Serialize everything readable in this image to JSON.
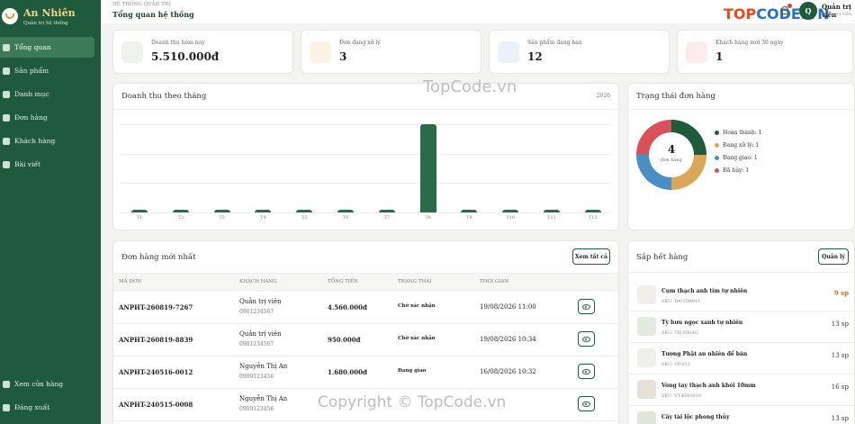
{
  "brand": {
    "name": "An Nhiên",
    "subtitle": "Quản trị hệ thống"
  },
  "nav": [
    {
      "label": "Tổng quan",
      "icon": "dashboard-icon",
      "active": true
    },
    {
      "label": "Sản phẩm",
      "icon": "tag-icon"
    },
    {
      "label": "Danh mục",
      "icon": "folder-icon"
    },
    {
      "label": "Đơn hàng",
      "icon": "receipt-icon"
    },
    {
      "label": "Khách hàng",
      "icon": "users-icon"
    },
    {
      "label": "Bài viết",
      "icon": "article-icon"
    }
  ],
  "nav_bottom": [
    {
      "label": "Xem cửa hàng",
      "icon": "store-icon"
    },
    {
      "label": "Đăng xuất",
      "icon": "logout-icon"
    }
  ],
  "topbar": {
    "small": "HỆ THỐNG QUẢN TRỊ",
    "title": "Tổng quan hệ thống",
    "avatar": "Q",
    "user": "Quản trị viên",
    "user_sub": "Quản trị viên"
  },
  "watermark_top": {
    "a": "TOP",
    "b": "CODE.VN"
  },
  "stats": [
    {
      "label": "Doanh thu hôm nay",
      "value": "5.510.000đ",
      "icon": "cash-icon",
      "bg": "#eef3ee"
    },
    {
      "label": "Đơn đang xử lý",
      "value": "3",
      "icon": "box-icon",
      "bg": "#fdf3e4"
    },
    {
      "label": "Sản phẩm đang bán",
      "value": "12",
      "icon": "gem-icon",
      "bg": "#eaf1fb"
    },
    {
      "label": "Khách hàng mới 30 ngày",
      "value": "1",
      "icon": "user-plus-icon",
      "bg": "#fcecee"
    }
  ],
  "revenue": {
    "title": "Doanh thu theo tháng",
    "year": "2026"
  },
  "chart_data": {
    "type": "bar",
    "categories": [
      "T1",
      "T2",
      "T3",
      "T4",
      "T5",
      "T6",
      "T7",
      "T8",
      "T9",
      "T10",
      "T11",
      "T12"
    ],
    "values": [
      0.03,
      0.03,
      0.03,
      0.03,
      0.03,
      0.03,
      0.03,
      1,
      0.03,
      0.03,
      0.03,
      0.03
    ],
    "title": "Doanh thu theo tháng",
    "ylim": [
      0,
      1
    ],
    "grid": true
  },
  "order_status": {
    "title": "Trạng thái đơn hàng",
    "total": "4",
    "total_label": "đơn hàng",
    "legend": [
      {
        "label": "Hoàn thành: 1",
        "color": "#1f5a3c"
      },
      {
        "label": "Đang xử lý: 1",
        "color": "#d9a65a"
      },
      {
        "label": "Đang giao: 1",
        "color": "#4a8ec4"
      },
      {
        "label": "Đã hủy: 1",
        "color": "#d8505a"
      }
    ]
  },
  "recent_orders": {
    "title": "Đơn hàng mới nhất",
    "view_all": "Xem tất cả",
    "headers": [
      "MÃ ĐƠN",
      "KHÁCH HÀNG",
      "TỔNG TIỀN",
      "TRẠNG THÁI",
      "THỜI GIAN"
    ],
    "rows": [
      {
        "id": "ANPHT-260819-7267",
        "name": "Quản trị viên",
        "phone": "0901234567",
        "total": "4.560.000đ",
        "status": "Chờ xác nhận",
        "time": "19/08/2026 11:00"
      },
      {
        "id": "ANPHT-260819-8839",
        "name": "Quản trị viên",
        "phone": "0901234567",
        "total": "950.000đ",
        "status": "Chờ xác nhận",
        "time": "19/08/2026 10:34"
      },
      {
        "id": "ANPHT-240516-0012",
        "name": "Nguyễn Thị An",
        "phone": "0909123456",
        "total": "1.680.000đ",
        "status": "Đang giao",
        "time": "16/08/2026 10:32"
      },
      {
        "id": "ANPHT-240515-0008",
        "name": "Nguyễn Thị An",
        "phone": "0909123456",
        "total": "",
        "status": "",
        "time": ""
      }
    ]
  },
  "low_stock": {
    "title": "Sắp hết hàng",
    "manage": "Quản lý",
    "items": [
      {
        "name": "Cụm thạch anh tím tự nhiên",
        "sku": "SKU: DA-TIM011",
        "qty": "9 sp",
        "warn": true
      },
      {
        "name": "Tỳ hưu ngọc xanh tự nhiên",
        "sku": "SKU: TH-NX002",
        "qty": "13 sp"
      },
      {
        "name": "Tượng Phật an nhiên để bàn",
        "sku": "SKU: TP-012",
        "qty": "13 sp"
      },
      {
        "name": "Vòng tay thạch anh khói 10mm",
        "sku": "SKU: VT-KHO010",
        "qty": "16 sp"
      },
      {
        "name": "Cây tài lộc phong thủy",
        "sku": "",
        "qty": "13 sp"
      }
    ]
  },
  "watermarks": {
    "center": "TopCode.vn",
    "bottom": "Copyright © TopCode.vn"
  }
}
